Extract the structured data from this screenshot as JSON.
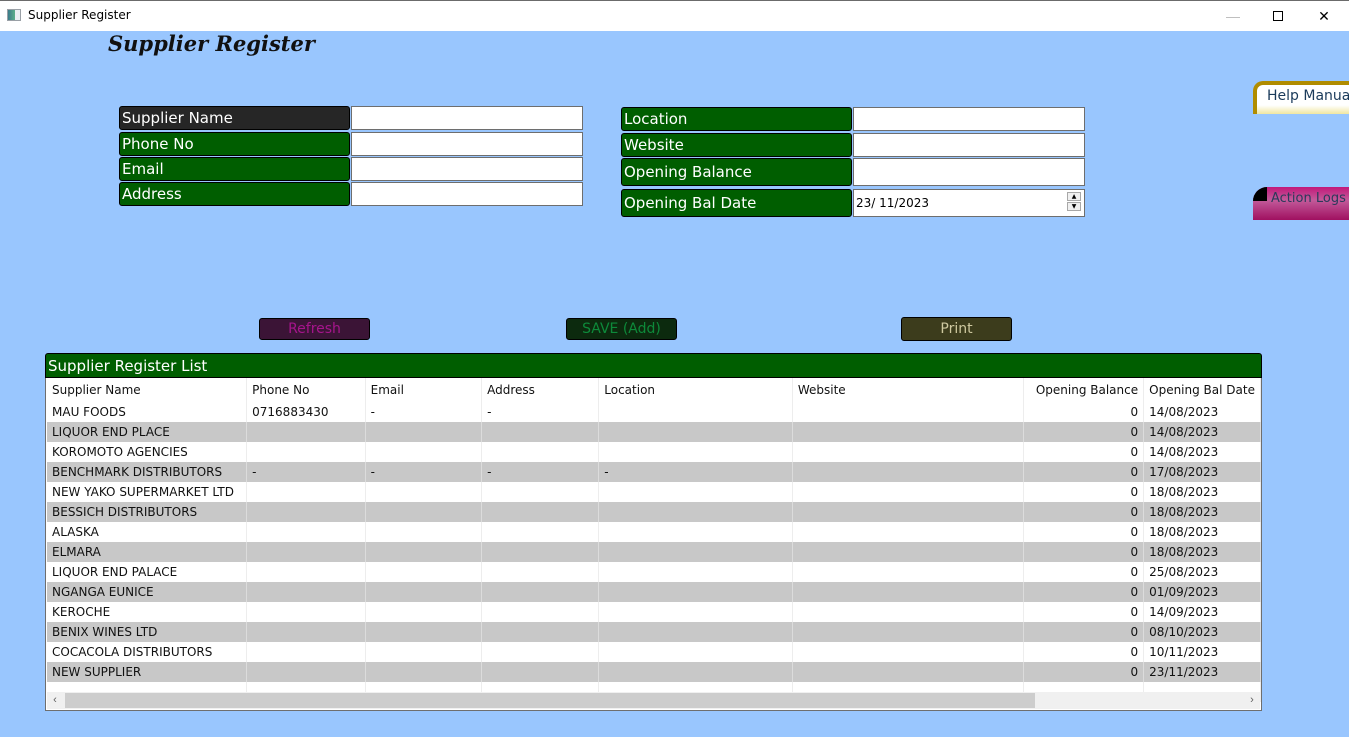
{
  "window": {
    "title": "Supplier Register",
    "minimize_icon": "minimize-icon",
    "maximize_icon": "maximize-icon",
    "close_icon": "close-icon",
    "close_glyph": "✕",
    "minimize_glyph": "—"
  },
  "page": {
    "title": "Supplier Register"
  },
  "form": {
    "left": [
      {
        "label": "Supplier Name",
        "value": ""
      },
      {
        "label": "Phone No",
        "value": ""
      },
      {
        "label": "Email",
        "value": ""
      },
      {
        "label": "Address",
        "value": ""
      }
    ],
    "right": [
      {
        "label": "Location",
        "value": ""
      },
      {
        "label": "Website",
        "value": ""
      },
      {
        "label": "Opening Balance",
        "value": ""
      },
      {
        "label": "Opening Bal Date",
        "value": "23/ 11/2023"
      }
    ],
    "spin_up": "▲",
    "spin_down": "▼"
  },
  "side_buttons": {
    "help": "Help Manual",
    "logs": "Action Logs"
  },
  "actions": {
    "refresh": "Refresh",
    "save": "SAVE (Add)",
    "print": "Print"
  },
  "list": {
    "title": "Supplier Register List",
    "columns": [
      "Supplier Name",
      "Phone No",
      "Email",
      "Address",
      "Location",
      "Website",
      "Opening Balance",
      "Opening Bal Date"
    ],
    "rows": [
      [
        "MAU FOODS",
        "0716883430",
        "-",
        "-",
        "",
        "",
        "0",
        "14/08/2023"
      ],
      [
        "LIQUOR END PLACE",
        "",
        "",
        "",
        "",
        "",
        "0",
        "14/08/2023"
      ],
      [
        "KOROMOTO AGENCIES",
        "",
        "",
        "",
        "",
        "",
        "0",
        "14/08/2023"
      ],
      [
        "BENCHMARK DISTRIBUTORS",
        "-",
        "-",
        "-",
        "-",
        "",
        "0",
        "17/08/2023"
      ],
      [
        "NEW YAKO SUPERMARKET LTD",
        "",
        "",
        "",
        "",
        "",
        "0",
        "18/08/2023"
      ],
      [
        "BESSICH DISTRIBUTORS",
        "",
        "",
        "",
        "",
        "",
        "0",
        "18/08/2023"
      ],
      [
        "ALASKA",
        "",
        "",
        "",
        "",
        "",
        "0",
        "18/08/2023"
      ],
      [
        "ELMARA",
        "",
        "",
        "",
        "",
        "",
        "0",
        "18/08/2023"
      ],
      [
        "LIQUOR END PALACE",
        "",
        "",
        "",
        "",
        "",
        "0",
        "25/08/2023"
      ],
      [
        "NGANGA EUNICE",
        "",
        "",
        "",
        "",
        "",
        "0",
        "01/09/2023"
      ],
      [
        "KEROCHE",
        "",
        "",
        "",
        "",
        "",
        "0",
        "14/09/2023"
      ],
      [
        "BENIX WINES LTD",
        "",
        "",
        "",
        "",
        "",
        "0",
        "08/10/2023"
      ],
      [
        "COCACOLA DISTRIBUTORS",
        "",
        "",
        "",
        "",
        "",
        "0",
        "10/11/2023"
      ],
      [
        "NEW SUPPLIER",
        "",
        "",
        "",
        "",
        "",
        "0",
        "23/11/2023"
      ]
    ],
    "scroll_left": "‹",
    "scroll_right": "›"
  }
}
